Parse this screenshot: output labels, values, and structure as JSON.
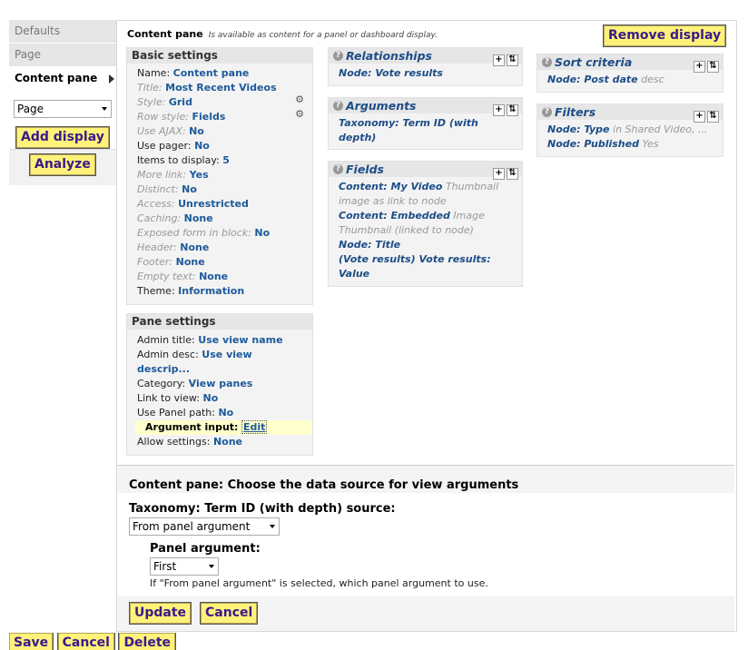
{
  "sidebar": {
    "tabs": [
      {
        "label": "Defaults",
        "active": false
      },
      {
        "label": "Page",
        "active": false
      },
      {
        "label": "Content pane",
        "active": true
      }
    ],
    "display_type_select": "Page",
    "add_display_label": "Add display",
    "analyze_label": "Analyze"
  },
  "header": {
    "title": "Content pane",
    "subtitle": "Is available as content for a panel or dashboard display.",
    "remove_display_label": "Remove display"
  },
  "basic_settings": {
    "title": "Basic settings",
    "rows": [
      {
        "label": "Name:",
        "value": "Content pane",
        "overridden": false
      },
      {
        "label": "Title:",
        "value": "Most Recent Videos",
        "overridden": true
      },
      {
        "label": "Style:",
        "value": "Grid",
        "overridden": true
      },
      {
        "label": "Row style:",
        "value": "Fields",
        "overridden": true
      },
      {
        "label": "Use AJAX:",
        "value": "No",
        "overridden": true
      },
      {
        "label": "Use pager:",
        "value": "No",
        "overridden": false
      },
      {
        "label": "Items to display:",
        "value": "5",
        "overridden": false
      },
      {
        "label": "More link:",
        "value": "Yes",
        "overridden": true
      },
      {
        "label": "Distinct:",
        "value": "No",
        "overridden": true
      },
      {
        "label": "Access:",
        "value": "Unrestricted",
        "overridden": true
      },
      {
        "label": "Caching:",
        "value": "None",
        "overridden": true
      },
      {
        "label": "Exposed form in block:",
        "value": "No",
        "overridden": true
      },
      {
        "label": "Header:",
        "value": "None",
        "overridden": true
      },
      {
        "label": "Footer:",
        "value": "None",
        "overridden": true
      },
      {
        "label": "Empty text:",
        "value": "None",
        "overridden": true
      },
      {
        "label": "Theme:",
        "value": "Information",
        "overridden": false
      }
    ]
  },
  "pane_settings": {
    "title": "Pane settings",
    "rows": [
      {
        "label": "Admin title:",
        "value": "Use view name"
      },
      {
        "label": "Admin desc:",
        "value": "Use view"
      },
      {
        "label": "",
        "value": "descrip..."
      },
      {
        "label": "Category:",
        "value": "View panes"
      },
      {
        "label": "Link to view:",
        "value": "No"
      },
      {
        "label": "Use Panel path:",
        "value": "No"
      },
      {
        "label": "Argument input:",
        "value": "Edit"
      },
      {
        "label": "Allow settings:",
        "value": "None"
      }
    ]
  },
  "relationships": {
    "title": "Relationships",
    "items": [
      {
        "main": "Node: Vote results",
        "extra": ""
      }
    ]
  },
  "arguments": {
    "title": "Arguments",
    "items": [
      {
        "main": "Taxonomy: Term ID (with",
        "extra": ""
      },
      {
        "main": "depth)",
        "extra": ""
      }
    ]
  },
  "fields": {
    "title": "Fields",
    "lines": [
      {
        "main": "Content: My Video",
        "extra": "Thumbnail"
      },
      {
        "main": "",
        "extra": "image as link to node"
      },
      {
        "main": "Content: Embedded",
        "extra": "Image"
      },
      {
        "main": "",
        "extra": "Thumbnail (linked to node)"
      },
      {
        "main": "Node: Title",
        "extra": ""
      },
      {
        "main": "(Vote results) Vote results:",
        "extra": ""
      },
      {
        "main": "Value",
        "extra": ""
      }
    ]
  },
  "sort_criteria": {
    "title": "Sort criteria",
    "items": [
      {
        "main": "Node: Post date",
        "extra": "desc"
      }
    ]
  },
  "filters": {
    "title": "Filters",
    "items": [
      {
        "main": "Node: Type",
        "extra": "in Shared Video, ..."
      },
      {
        "main": "Node: Published",
        "extra": "Yes"
      }
    ]
  },
  "form": {
    "title": "Content pane: Choose the data source for view arguments",
    "source_label": "Taxonomy: Term ID (with depth) source:",
    "source_value": "From panel argument",
    "panel_argument_label": "Panel argument:",
    "panel_argument_value": "First",
    "description": "If \"From panel argument\" is selected, which panel argument to use.",
    "update_label": "Update",
    "cancel_label": "Cancel"
  },
  "bottom_bar": {
    "save_label": "Save",
    "cancel_label": "Cancel",
    "delete_label": "Delete"
  }
}
